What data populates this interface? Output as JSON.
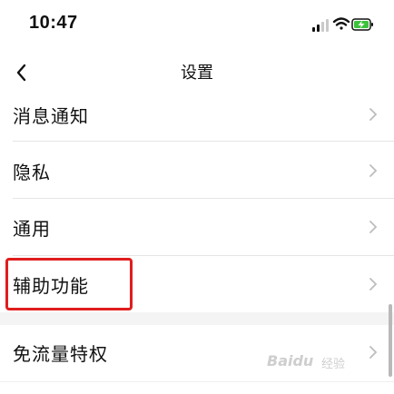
{
  "status_bar": {
    "time": "10:47",
    "icons": [
      "signal-icon",
      "wifi-icon",
      "battery-charging-icon"
    ],
    "battery_color": "#3cc23c"
  },
  "nav": {
    "back_icon": "chevron-left-icon",
    "title": "设置"
  },
  "settings_items": [
    {
      "label": "消息通知"
    },
    {
      "label": "隐私"
    },
    {
      "label": "通用"
    },
    {
      "label": "辅助功能",
      "highlighted": true
    },
    {
      "label": "免流量特权"
    }
  ],
  "highlight_color": "#e01d1d",
  "watermark": {
    "brand": "Baidu",
    "sub": "经验"
  }
}
